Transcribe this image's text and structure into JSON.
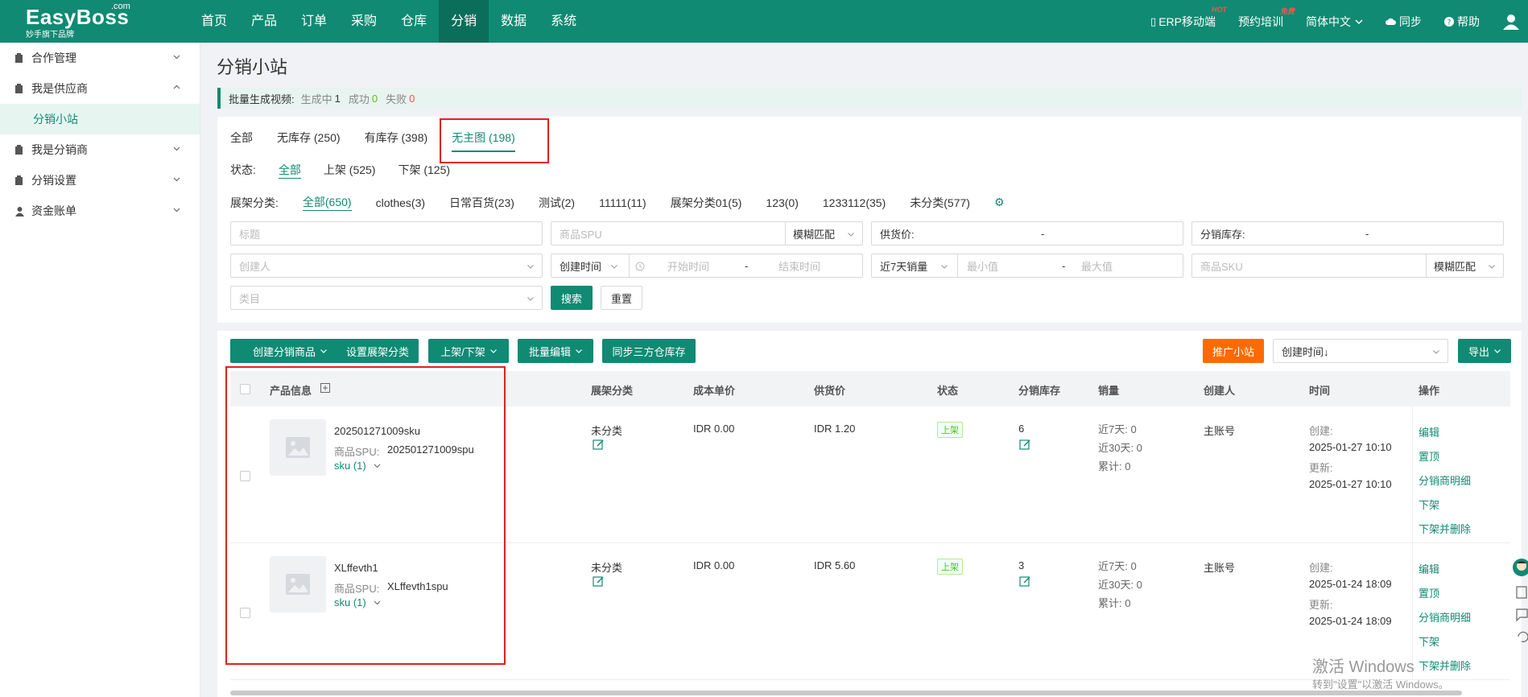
{
  "brand": {
    "name": "EasyBoss",
    "com": ".com",
    "tagline": "妙手旗下品牌"
  },
  "nav": [
    "首页",
    "产品",
    "订单",
    "采购",
    "仓库",
    "分销",
    "数据",
    "系统"
  ],
  "top_right": {
    "erp": "ERP移动端",
    "erp_badge": "HOT",
    "training": "预约培训",
    "training_badge": "免费",
    "language": "简体中文",
    "sync": "同步",
    "help": "帮助"
  },
  "sidebar": {
    "items": [
      "合作管理",
      "我是供应商",
      "我是分销商",
      "分销设置",
      "资金账单"
    ],
    "active_sub": "分销小站"
  },
  "page_title": "分销小站",
  "notice": {
    "label": "批量生成视频:",
    "generating_label": "生成中",
    "generating": "1",
    "success_label": "成功",
    "success": "0",
    "fail_label": "失败",
    "fail": "0"
  },
  "tabs": [
    "全部",
    "无库存 (250)",
    "有库存 (398)",
    "无主图 (198)"
  ],
  "status": {
    "label": "状态:",
    "options": [
      "全部",
      "上架 (525)",
      "下架 (125)"
    ]
  },
  "categories": {
    "label": "展架分类:",
    "options": [
      "全部(650)",
      "clothes(3)",
      "日常百货(23)",
      "测试(2)",
      "11111(11)",
      "展架分类01(5)",
      "123(0)",
      "1233112(35)",
      "未分类(577)"
    ]
  },
  "filters": {
    "title_ph": "标题",
    "spu_ph": "商品SPU",
    "spu_match": "模糊匹配",
    "supply_price": "供货价:",
    "dist_stock": "分销库存:",
    "dash": "-",
    "creator_ph": "创建人",
    "create_time": "创建时间",
    "start_ph": "开始时间",
    "end_ph": "结束时间",
    "sales_7d": "近7天销量",
    "min_ph": "最小值",
    "max_ph": "最大值",
    "sku_ph": "商品SKU",
    "sku_match": "模糊匹配",
    "category_ph": "类目",
    "search": "搜索",
    "reset": "重置"
  },
  "actions": {
    "create": "创建分销商品",
    "set_category": "设置展架分类",
    "shelf": "上架/下架",
    "batch_edit": "批量编辑",
    "sync_stock": "同步三方仓库存",
    "promote": "推广小站",
    "sort": "创建时间↓",
    "export": "导出"
  },
  "table": {
    "headers": [
      "产品信息",
      "展架分类",
      "成本单价",
      "供货价",
      "状态",
      "分销库存",
      "销量",
      "创建人",
      "时间",
      "操作"
    ],
    "rows": [
      {
        "name": "202501271009sku",
        "spu_label": "商品SPU:",
        "spu": "202501271009spu",
        "sku": "sku (1)",
        "category": "未分类",
        "cost": "IDR 0.00",
        "price": "IDR 1.20",
        "status": "上架",
        "stock": "6",
        "sales_7d": "近7天: 0",
        "sales_30d": "近30天: 0",
        "sales_total": "累计: 0",
        "creator": "主账号",
        "created_label": "创建:",
        "created": "2025-01-27 10:10",
        "updated_label": "更新:",
        "updated": "2025-01-27 10:10",
        "ops": [
          "编辑",
          "置顶",
          "分销商明细",
          "下架",
          "下架并删除"
        ]
      },
      {
        "name": "XLffevth1",
        "spu_label": "商品SPU:",
        "spu": "XLffevth1spu",
        "sku": "sku (1)",
        "category": "未分类",
        "cost": "IDR 0.00",
        "price": "IDR 5.60",
        "status": "上架",
        "stock": "3",
        "sales_7d": "近7天: 0",
        "sales_30d": "近30天: 0",
        "sales_total": "累计: 0",
        "creator": "主账号",
        "created_label": "创建:",
        "created": "2025-01-24 18:09",
        "updated_label": "更新:",
        "updated": "2025-01-24 18:09",
        "ops": [
          "编辑",
          "置顶",
          "分销商明细",
          "下架",
          "下架并删除"
        ]
      }
    ]
  },
  "watermark": {
    "line1": "激活 Windows",
    "line2": "转到\"设置\"以激活 Windows。"
  },
  "colors": {
    "primary": "#108a73",
    "orange": "#ff6a00",
    "highlight_box": "#e02020"
  }
}
